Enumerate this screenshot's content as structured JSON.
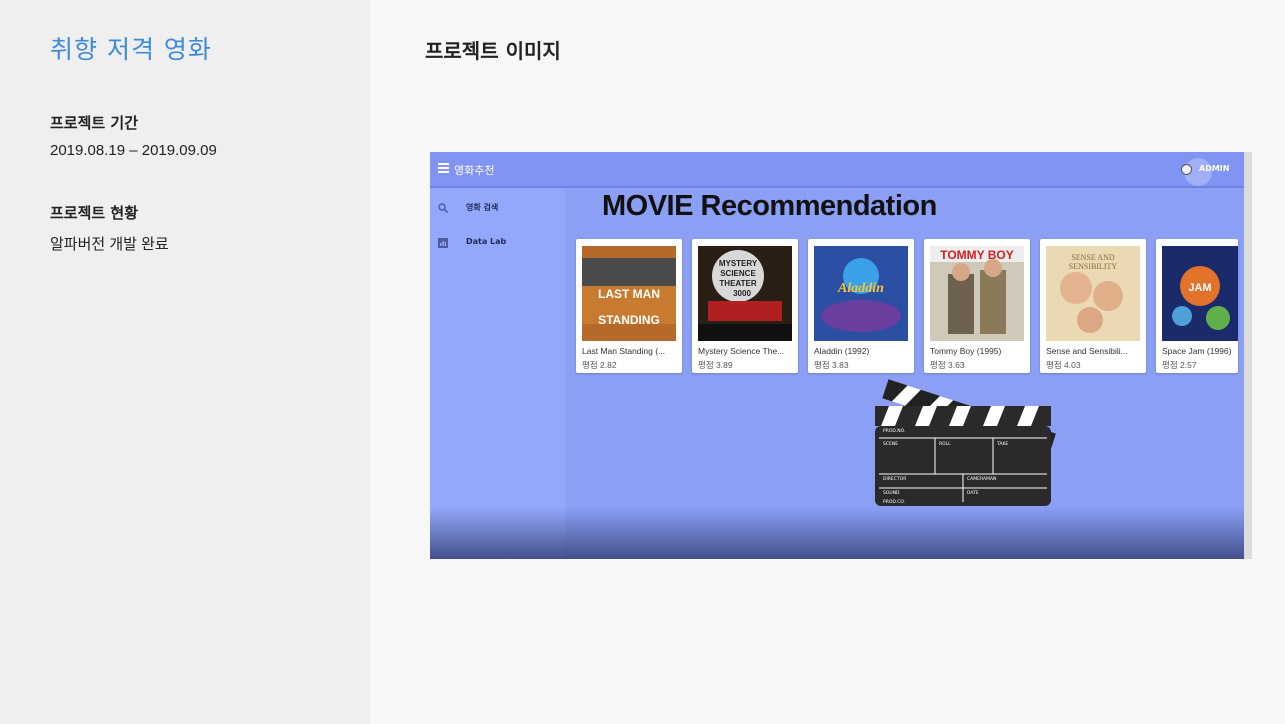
{
  "sidebar": {
    "title": "취향 저격 영화",
    "period_label": "프로젝트 기간",
    "period_value": "2019.08.19 – 2019.09.09",
    "status_label": "프로젝트 현황",
    "status_value": "알파버전 개발 완료"
  },
  "main": {
    "title": "프로젝트 이미지"
  },
  "app": {
    "title": "영화추천",
    "admin_label": "ADMIN",
    "heading": "MOVIE Recommendation",
    "nav": [
      {
        "label": "영화 검색",
        "icon": "search-icon"
      },
      {
        "label": "Data Lab",
        "icon": "chart-icon"
      }
    ],
    "movies": [
      {
        "title": "Last Man Standing (...",
        "rating": "평점 2.82",
        "poster_color": "#b56a2a",
        "poster_text": "LAST MAN STANDING"
      },
      {
        "title": "Mystery Science The...",
        "rating": "평점 3.89",
        "poster_color": "#3a2a1a",
        "poster_text": "MYSTERY SCIENCE THEATER 3000"
      },
      {
        "title": "Aladdin (1992)",
        "rating": "평점 3.83",
        "poster_color": "#2b4fa3",
        "poster_text": "Aladdin"
      },
      {
        "title": "Tommy Boy (1995)",
        "rating": "평점 3.63",
        "poster_color": "#8a7a5a",
        "poster_text": "TOMMY BOY"
      },
      {
        "title": "Sense and Sensibili...",
        "rating": "평점 4.03",
        "poster_color": "#e8d9b0",
        "poster_text": "SENSE AND SENSIBILITY"
      },
      {
        "title": "Space Jam (1996)",
        "rating": "평점 2.57",
        "poster_color": "#1b2a6b",
        "poster_text": "SPACE JAM"
      }
    ],
    "clapper": {
      "prod_no": "PROD.NO.",
      "scene": "SCENE",
      "roll": "ROLL",
      "take": "TAKE",
      "director": "DIRECTOR",
      "cameraman": "CAMERAMAN",
      "sound": "SOUND",
      "date": "DATE",
      "prod_co": "PROD.CO."
    }
  }
}
